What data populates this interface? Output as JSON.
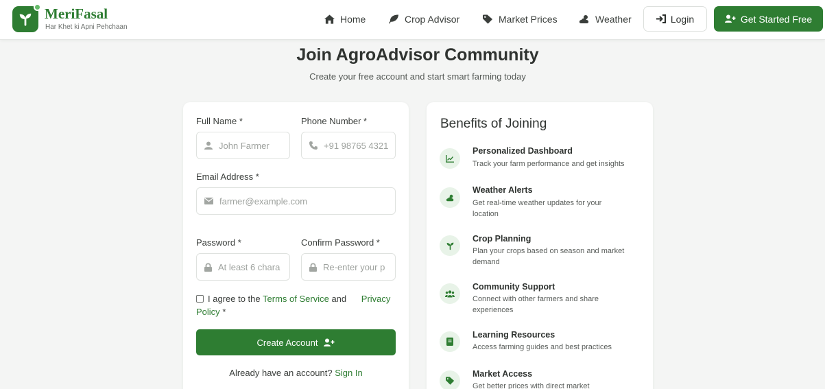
{
  "brand": {
    "name_part1": "Meri",
    "name_part2": "Fasal",
    "tagline": "Har Khet ki Apni Pehchaan",
    "color": "#2e7d32"
  },
  "nav": {
    "items": [
      {
        "label": "Home",
        "icon": "home-icon"
      },
      {
        "label": "Crop Advisor",
        "icon": "leaf-icon"
      },
      {
        "label": "Market Prices",
        "icon": "tag-icon"
      },
      {
        "label": "Weather",
        "icon": "cloud-sun-icon"
      }
    ],
    "login_label": "Login",
    "get_started_label": "Get Started Free"
  },
  "page": {
    "title": "Join AgroAdvisor Community",
    "subtitle": "Create your free account and start smart farming today"
  },
  "form": {
    "full_name_label": "Full Name *",
    "full_name_placeholder": "John Farmer",
    "phone_label": "Phone Number *",
    "phone_placeholder": "+91 98765 4321",
    "email_label": "Email Address *",
    "email_placeholder": "farmer@example.com",
    "password_label": "Password *",
    "password_placeholder": "At least 6 chara",
    "confirm_label": "Confirm Password *",
    "confirm_placeholder": "Re-enter your p",
    "agree_prefix": "I agree to the",
    "terms_link": "Terms of Service",
    "agree_and": "and",
    "privacy_link": "Privacy Policy",
    "agree_suffix": "*",
    "create_button": "Create Account",
    "have_account": "Already have an account?",
    "sign_in_link": "Sign In"
  },
  "benefits": {
    "title": "Benefits of Joining",
    "items": [
      {
        "title": "Personalized Dashboard",
        "desc": "Track your farm performance and get insights",
        "icon": "chart-line-icon"
      },
      {
        "title": "Weather Alerts",
        "desc": "Get real-time weather updates for your location",
        "icon": "cloud-sun-icon"
      },
      {
        "title": "Crop Planning",
        "desc": "Plan your crops based on season and market demand",
        "icon": "seedling-icon"
      },
      {
        "title": "Community Support",
        "desc": "Connect with other farmers and share experiences",
        "icon": "users-icon"
      },
      {
        "title": "Learning Resources",
        "desc": "Access farming guides and best practices",
        "icon": "book-icon"
      },
      {
        "title": "Market Access",
        "desc": "Get better prices with direct market",
        "icon": "tags-icon"
      }
    ]
  }
}
